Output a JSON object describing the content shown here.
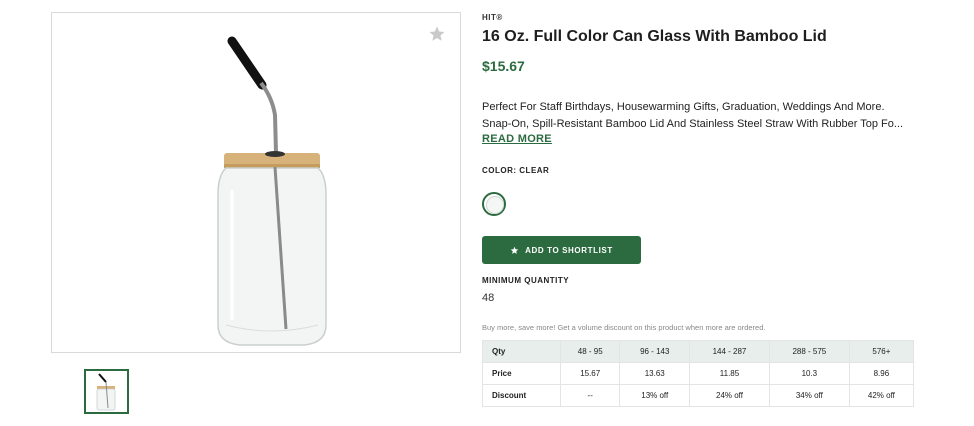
{
  "product": {
    "brand": "HIT®",
    "title": "16 Oz. Full Color Can Glass With Bamboo Lid",
    "price": "$15.67",
    "description": [
      "Perfect For Staff Birthdays, Housewarming Gifts, Graduation, Weddings And More.",
      "Snap-On, Spill-Resistant Bamboo Lid And Stainless Steel Straw With Rubber Top Fo..."
    ],
    "read_more": "READ MORE",
    "color_label": "COLOR: CLEAR",
    "shortlist_button": "ADD TO SHORTLIST",
    "minimum_quantity_label": "MINIMUM QUANTITY",
    "minimum_quantity": "48",
    "volume_note": "Buy more, save more! Get a volume discount on this product when more are ordered."
  },
  "pricing_table": {
    "header": [
      "Qty",
      "48 - 95",
      "96 - 143",
      "144 - 287",
      "288 - 575",
      "576+"
    ],
    "rows": [
      [
        "Price",
        "15.67",
        "13.63",
        "11.85",
        "10.3",
        "8.96"
      ],
      [
        "Discount",
        "--",
        "13% off",
        "24% off",
        "34% off",
        "42% off"
      ]
    ]
  },
  "colors": {
    "accent": "#2c6b3f",
    "table_header_bg": "#e7eeeb"
  },
  "icons": {
    "favorite": "star-icon",
    "button": "star-icon"
  }
}
